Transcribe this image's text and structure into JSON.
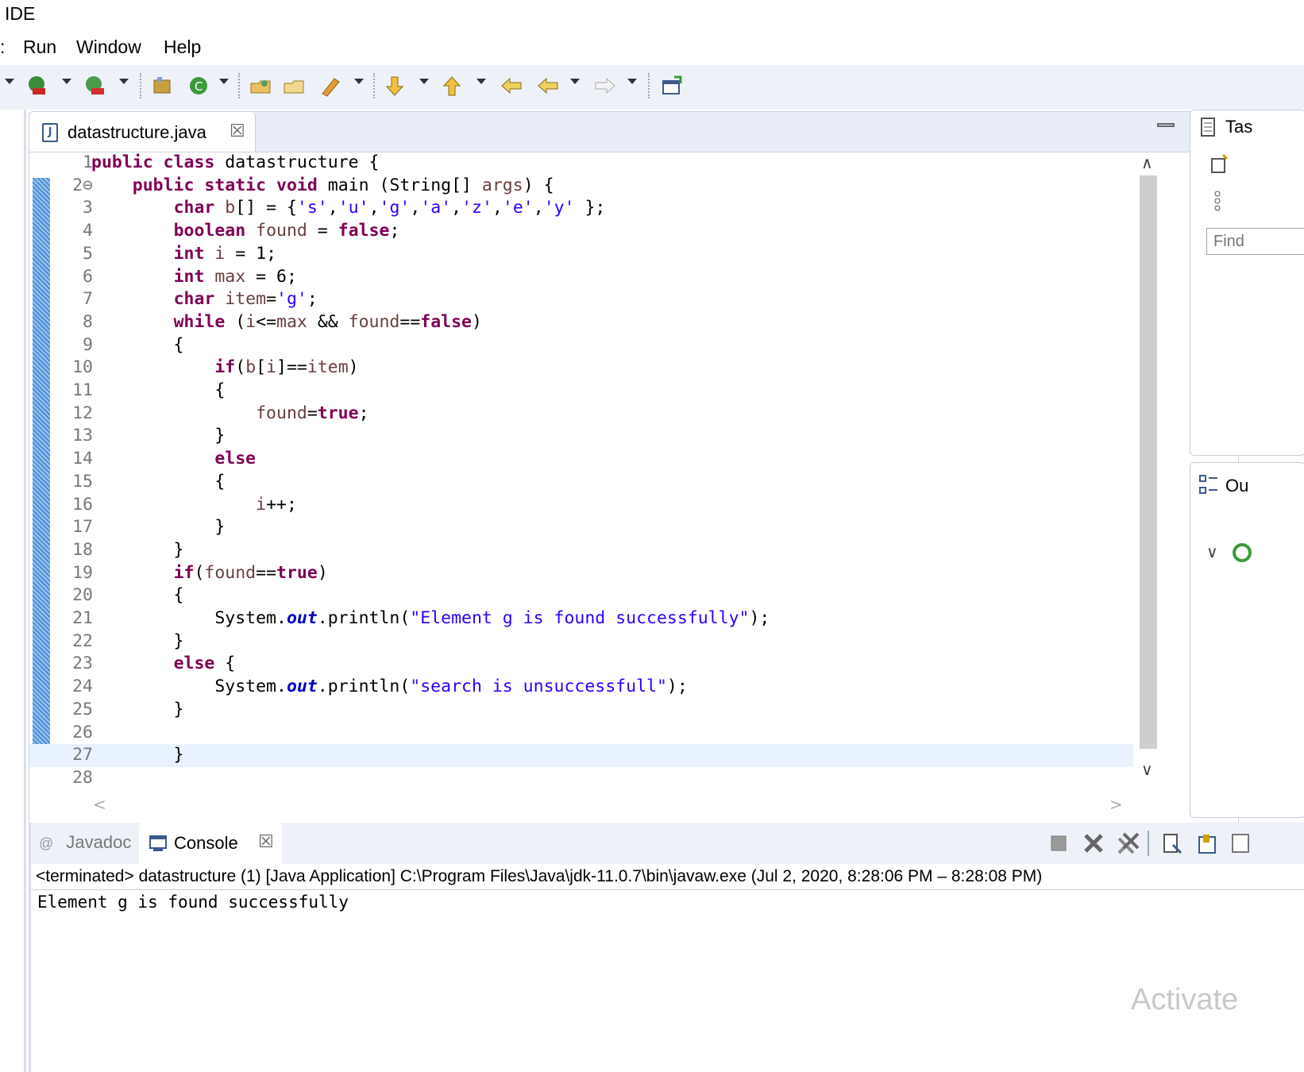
{
  "window": {
    "title": "IDE"
  },
  "menu": {
    "items": [
      ":",
      "Run",
      "Window",
      "Help"
    ]
  },
  "toolbar": {
    "icons": [
      "debug-icon",
      "run-icon",
      "coverage-icon",
      "new-java-package-icon",
      "new-class-icon",
      "open-type-icon",
      "open-task-icon",
      "search-icon",
      "next-annotation-icon",
      "previous-annotation-icon",
      "last-edit-icon",
      "back-icon",
      "forward-icon",
      "open-perspective-icon"
    ]
  },
  "editor": {
    "tab_label": "datastructure.java",
    "tab_icon": "java-file-icon",
    "tab_icon_glyph": "J",
    "close_glyph": "☒",
    "current_line": 27,
    "lines": [
      {
        "n": "1",
        "code": [
          [
            "kw",
            "public"
          ],
          [
            "t",
            " "
          ],
          [
            "kw",
            "class"
          ],
          [
            "t",
            " datastructure {"
          ]
        ]
      },
      {
        "n": "2⊖",
        "code": [
          [
            "t",
            "    "
          ],
          [
            "kw",
            "public"
          ],
          [
            "t",
            " "
          ],
          [
            "kw",
            "static"
          ],
          [
            "t",
            " "
          ],
          [
            "kw",
            "void"
          ],
          [
            "t",
            " main (String[] "
          ],
          [
            "var",
            "args"
          ],
          [
            "t",
            ") {"
          ]
        ]
      },
      {
        "n": "3",
        "code": [
          [
            "t",
            "        "
          ],
          [
            "kw",
            "char"
          ],
          [
            "t",
            " "
          ],
          [
            "var",
            "b"
          ],
          [
            "t",
            "[] = {"
          ],
          [
            "str",
            "'s'"
          ],
          [
            "t",
            ","
          ],
          [
            "str",
            "'u'"
          ],
          [
            "t",
            ","
          ],
          [
            "str",
            "'g'"
          ],
          [
            "t",
            ","
          ],
          [
            "str",
            "'a'"
          ],
          [
            "t",
            ","
          ],
          [
            "str",
            "'z'"
          ],
          [
            "t",
            ","
          ],
          [
            "str",
            "'e'"
          ],
          [
            "t",
            ","
          ],
          [
            "str",
            "'y'"
          ],
          [
            "t",
            " };"
          ]
        ]
      },
      {
        "n": "4",
        "code": [
          [
            "t",
            "        "
          ],
          [
            "kw",
            "boolean"
          ],
          [
            "t",
            " "
          ],
          [
            "var",
            "found"
          ],
          [
            "t",
            " = "
          ],
          [
            "kw",
            "false"
          ],
          [
            "t",
            ";"
          ]
        ]
      },
      {
        "n": "5",
        "code": [
          [
            "t",
            "        "
          ],
          [
            "kw",
            "int"
          ],
          [
            "t",
            " "
          ],
          [
            "var",
            "i"
          ],
          [
            "t",
            " = 1;"
          ]
        ]
      },
      {
        "n": "6",
        "code": [
          [
            "t",
            "        "
          ],
          [
            "kw",
            "int"
          ],
          [
            "t",
            " "
          ],
          [
            "var",
            "max"
          ],
          [
            "t",
            " = 6;"
          ]
        ]
      },
      {
        "n": "7",
        "code": [
          [
            "t",
            "        "
          ],
          [
            "kw",
            "char"
          ],
          [
            "t",
            " "
          ],
          [
            "var",
            "item"
          ],
          [
            "t",
            "="
          ],
          [
            "str",
            "'g'"
          ],
          [
            "t",
            ";"
          ]
        ]
      },
      {
        "n": "8",
        "code": [
          [
            "t",
            "        "
          ],
          [
            "kw",
            "while"
          ],
          [
            "t",
            " ("
          ],
          [
            "var",
            "i"
          ],
          [
            "t",
            "<="
          ],
          [
            "var",
            "max"
          ],
          [
            "t",
            " && "
          ],
          [
            "var",
            "found"
          ],
          [
            "t",
            "=="
          ],
          [
            "kw",
            "false"
          ],
          [
            "t",
            ")"
          ]
        ]
      },
      {
        "n": "9",
        "code": [
          [
            "t",
            "        {"
          ]
        ]
      },
      {
        "n": "10",
        "code": [
          [
            "t",
            "            "
          ],
          [
            "kw",
            "if"
          ],
          [
            "t",
            "("
          ],
          [
            "var",
            "b"
          ],
          [
            "t",
            "["
          ],
          [
            "var",
            "i"
          ],
          [
            "t",
            "]=="
          ],
          [
            "var",
            "item"
          ],
          [
            "t",
            ")"
          ]
        ]
      },
      {
        "n": "11",
        "code": [
          [
            "t",
            "            {"
          ]
        ]
      },
      {
        "n": "12",
        "code": [
          [
            "t",
            "                "
          ],
          [
            "var",
            "found"
          ],
          [
            "t",
            "="
          ],
          [
            "kw",
            "true"
          ],
          [
            "t",
            ";"
          ]
        ]
      },
      {
        "n": "13",
        "code": [
          [
            "t",
            "            }"
          ]
        ]
      },
      {
        "n": "14",
        "code": [
          [
            "t",
            "            "
          ],
          [
            "kw",
            "else"
          ]
        ]
      },
      {
        "n": "15",
        "code": [
          [
            "t",
            "            {"
          ]
        ]
      },
      {
        "n": "16",
        "code": [
          [
            "t",
            "                "
          ],
          [
            "var",
            "i"
          ],
          [
            "t",
            "++;"
          ]
        ]
      },
      {
        "n": "17",
        "code": [
          [
            "t",
            "            }"
          ]
        ]
      },
      {
        "n": "18",
        "code": [
          [
            "t",
            "        }"
          ]
        ]
      },
      {
        "n": "19",
        "code": [
          [
            "t",
            "        "
          ],
          [
            "kw",
            "if"
          ],
          [
            "t",
            "("
          ],
          [
            "var",
            "found"
          ],
          [
            "t",
            "=="
          ],
          [
            "kw",
            "true"
          ],
          [
            "t",
            ")"
          ]
        ]
      },
      {
        "n": "20",
        "code": [
          [
            "t",
            "        {"
          ]
        ]
      },
      {
        "n": "21",
        "code": [
          [
            "t",
            "            System."
          ],
          [
            "fld",
            "out"
          ],
          [
            "t",
            ".println("
          ],
          [
            "str",
            "\"Element g is found successfully\""
          ],
          [
            "t",
            ");"
          ]
        ]
      },
      {
        "n": "22",
        "code": [
          [
            "t",
            "        }"
          ]
        ]
      },
      {
        "n": "23",
        "code": [
          [
            "t",
            "        "
          ],
          [
            "kw",
            "else"
          ],
          [
            "t",
            " {"
          ]
        ]
      },
      {
        "n": "24",
        "code": [
          [
            "t",
            "            System."
          ],
          [
            "fld",
            "out"
          ],
          [
            "t",
            ".println("
          ],
          [
            "str",
            "\"search is unsuccessfull\""
          ],
          [
            "t",
            ");"
          ]
        ]
      },
      {
        "n": "25",
        "code": [
          [
            "t",
            "        }"
          ]
        ]
      },
      {
        "n": "26",
        "code": [
          [
            "t",
            ""
          ]
        ]
      },
      {
        "n": "27",
        "code": [
          [
            "t",
            "        }"
          ]
        ]
      },
      {
        "n": "28",
        "code": [
          [
            "t",
            ""
          ]
        ]
      }
    ]
  },
  "right_panel": {
    "task_label": "Tas",
    "find_placeholder": "Find",
    "outline_label": "Ou"
  },
  "console": {
    "tabs": [
      {
        "label": "Javadoc",
        "icon": "at-icon",
        "icon_glyph": "@"
      },
      {
        "label": "Console",
        "icon": "console-icon"
      }
    ],
    "status": "<terminated> datastructure (1) [Java Application] C:\\Program Files\\Java\\jdk-11.0.7\\bin\\javaw.exe  (Jul 2, 2020, 8:28:06 PM – 8:28:08 PM)",
    "output": "Element g is found successfully",
    "toolbar_icons": [
      "terminate-icon",
      "remove-launch-icon",
      "remove-all-terminated-icon",
      "scroll-lock-icon",
      "word-wrap-icon",
      "display-selected-console-icon"
    ]
  },
  "watermark": "Activate"
}
